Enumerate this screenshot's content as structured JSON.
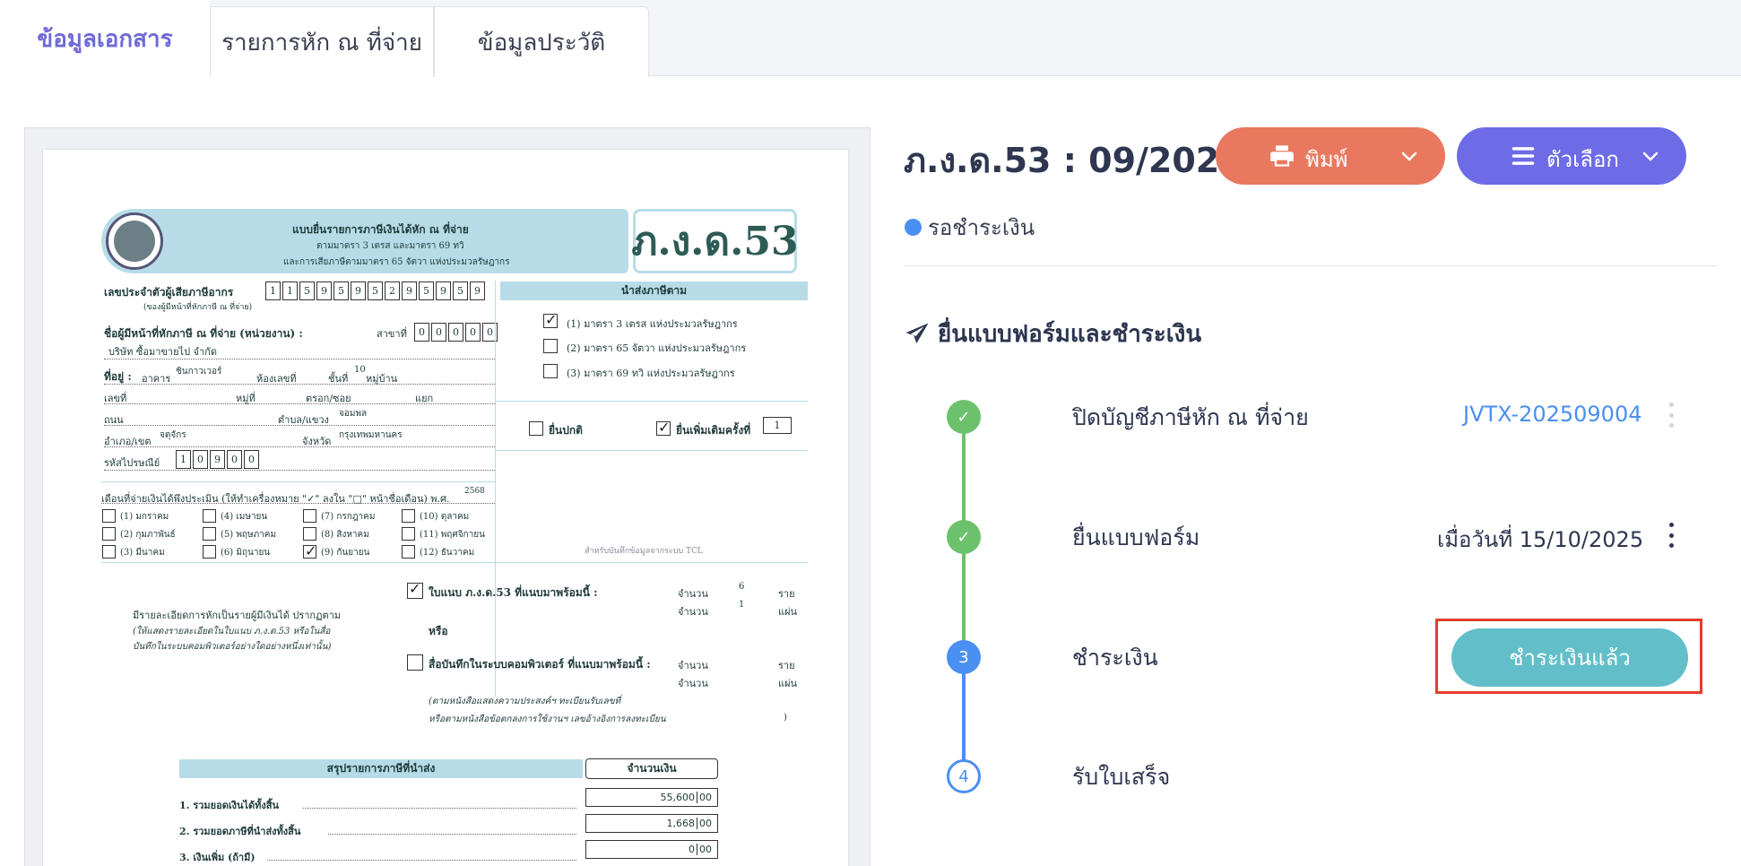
{
  "tabs": [
    {
      "label": "ข้อมูลเอกสาร",
      "active": true
    },
    {
      "label": "รายการหัก ณ ที่จ่าย",
      "active": false
    },
    {
      "label": "ข้อมูลประวัติ",
      "active": false
    }
  ],
  "header": {
    "title": "ภ.ง.ด.53 : 09/2025",
    "print_label": "พิมพ์",
    "options_label": "ตัวเลือก"
  },
  "status": {
    "label": "รอชำระเงิน",
    "color": "#4a8ff2"
  },
  "section": {
    "title": "ยื่นแบบฟอร์มและชำระเงิน"
  },
  "steps": [
    {
      "label": "ปิดบัญชีภาษีหัก ณ ที่จ่าย",
      "state": "done",
      "link": "JVTX-202509004"
    },
    {
      "label": "ยื่นแบบฟอร์ม",
      "state": "done",
      "date": "เมื่อวันที่ 15/10/2025"
    },
    {
      "label": "ชำระเงิน",
      "state": "current",
      "number": "3",
      "action_label": "ชำระเงินแล้ว"
    },
    {
      "label": "รับใบเสร็จ",
      "state": "pending",
      "number": "4"
    }
  ],
  "colors": {
    "accent": "#6d6be6",
    "print": "#e8795f",
    "success": "#6cc26c",
    "pay": "#62bfc9",
    "highlight": "#e53d2c"
  },
  "form": {
    "heading_1": "แบบยื่นรายการภาษีเงินได้หัก ณ ที่จ่าย",
    "heading_2": "ตามมาตรา 3 เตรส และมาตรา 69 ทวิ",
    "heading_3": "และการเสียภาษีตามมาตรา 65 จัตวา แห่งประมวลรัษฎากร",
    "form_code": "ภ.ง.ด.53",
    "taxid_label": "เลขประจำตัวผู้เสียภาษีอากร",
    "taxid_sub": "(ของผู้มีหน้าที่หักภาษี ณ ที่จ่าย)",
    "taxid_digits": [
      "1",
      "1",
      "5",
      "9",
      "5",
      "9",
      "5",
      "2",
      "9",
      "5",
      "9",
      "5",
      "9"
    ],
    "payer_label": "ชื่อผู้มีหน้าที่หักภาษี ณ ที่จ่าย (หน่วยงาน) :",
    "branch_label": "สาขาที่",
    "branch_digits": [
      "0",
      "0",
      "0",
      "0",
      "0"
    ],
    "company": "บริษัท ซื้อมาขายไป จำกัด",
    "address_label": "ที่อยู่ :",
    "building_label": "อาคาร",
    "building": "ชินกาวเวอร์",
    "room_label": "ห้องเลขที่",
    "floor_label": "ชั้นที่",
    "floor": "10",
    "village_label": "หมู่บ้าน",
    "number_label": "เลขที่",
    "moo_label": "หมู่ที่",
    "soi_label": "ตรอก/ซอย",
    "junction_label": "แยก",
    "road_label": "ถนน",
    "subdistrict_label": "ตำบล/แขวง",
    "subdistrict": "จอมพล",
    "district_label": "อำเภอ/เขต",
    "district": "จตุจักร",
    "province_label": "จังหวัด",
    "province": "กรุงเทพมหานคร",
    "postal_label": "รหัสไปรษณีย์",
    "postal_digits": [
      "1",
      "0",
      "9",
      "0",
      "0"
    ],
    "submit_band": "นำส่งภาษีตาม",
    "law_1": "(1) มาตรา 3 เตรส แห่งประมวลรัษฎากร",
    "law_2": "(2) มาตรา 65 จัตวา แห่งประมวลรัษฎากร",
    "law_3": "(3) มาตรา 69 ทวิ แห่งประมวลรัษฎากร",
    "normal_label": "ยื่นปกติ",
    "extra_label": "ยื่นเพิ่มเติมครั้งที่",
    "extra_no": "1",
    "month_label": "เดือนที่จ่ายเงินได้พึงประเมิน (ให้ทำเครื่องหมาย \"✓\" ลงใน \"□\" หน้าชื่อเดือน) พ.ศ.",
    "year": "2568",
    "months": [
      "(1) มกราคม",
      "(2) กุมภาพันธ์",
      "(3) มีนาคม",
      "(4) เมษายน",
      "(5) พฤษภาคม",
      "(6) มิถุนายน",
      "(7) กรกฎาคม",
      "(8) สิงหาคม",
      "(9) กันยายน",
      "(10) ตุลาคม",
      "(11) พฤศจิกายน",
      "(12) ธันวาคม"
    ],
    "tcl_note": "สำหรับบันทึกข้อมูลจากระบบ TCL",
    "detail_1": "มีรายละเอียดการหักเป็นรายผู้มีเงินได้ ปรากฏตาม",
    "detail_2": "(ให้แสดงรายละเอียดในใบแนบ ภ.ง.ด.53 หรือในสื่อ",
    "detail_3": "บันทึกในระบบคอมพิวเตอร์อย่างใดอย่างหนึ่งเท่านั้น)",
    "attach_label": "ใบแนบ ภ.ง.ด.53 ที่แนบมาพร้อมนี้ :",
    "amount_label": "จำนวน",
    "count_1": "6",
    "unit_1": "ราย",
    "count_2": "1",
    "unit_2": "แผ่น",
    "or_label": "หรือ",
    "media_label": "สื่อบันทึกในระบบคอมพิวเตอร์ ที่แนบมาพร้อมนี้ :",
    "note_1": "(ตามหนังสือแสดงความประสงค์ฯ ทะเบียนรับเลขที่",
    "note_2": "หรือตามหนังสือข้อตกลงการใช้งานฯ เลขอ้างอิงการลงทะเบียน",
    "note_close": ")",
    "summary_band": "สรุปรายการภาษีที่นำส่ง",
    "amount_band": "จำนวนเงิน",
    "sum_1_label": "1. รวมยอดเงินได้ทั้งสิ้น",
    "sum_1_value": "55,600",
    "sum_1_cents": "00",
    "sum_2_label": "2. รวมยอดภาษีที่นำส่งทั้งสิ้น",
    "sum_2_value": "1,668",
    "sum_2_cents": "00",
    "sum_3_label": "3. เงินเพิ่ม (ถ้ามี)",
    "sum_3_value": "0",
    "sum_3_cents": "00"
  }
}
